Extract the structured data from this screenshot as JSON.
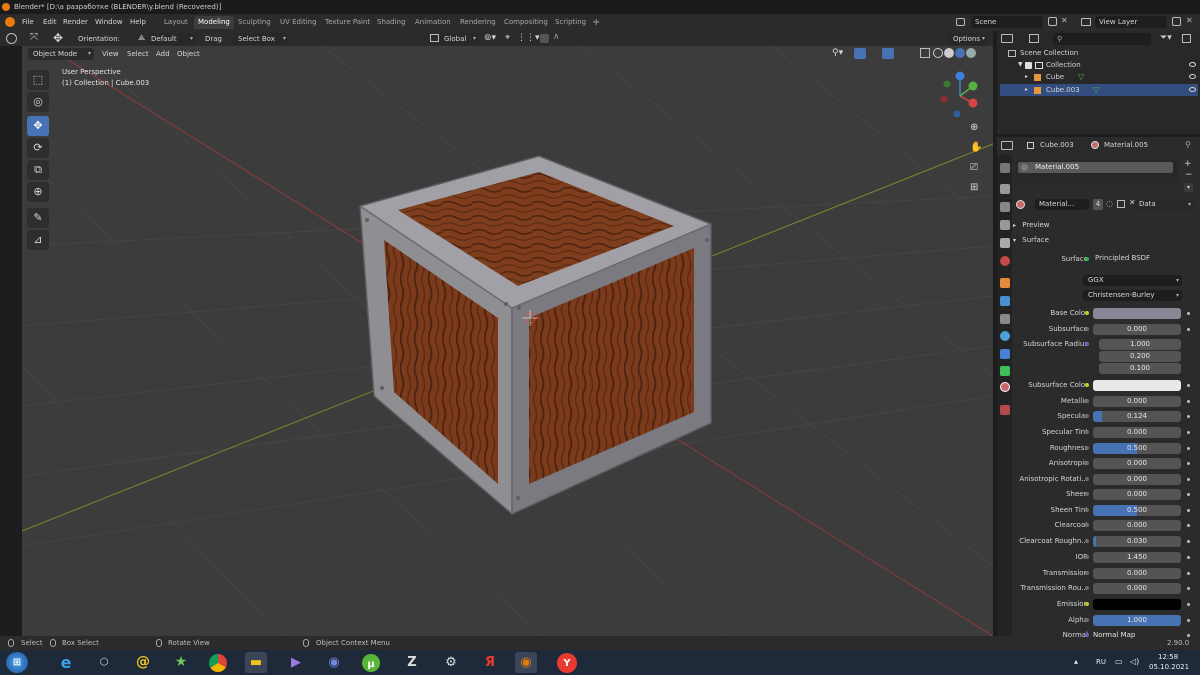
{
  "window": {
    "title": "Blender* [D:\\a разработке (BLENDER\\y.blend (Recovered)]"
  },
  "menu": {
    "items": [
      "File",
      "Edit",
      "Render",
      "Window",
      "Help"
    ],
    "workspaces": [
      "Layout",
      "Modeling",
      "Sculpting",
      "UV Editing",
      "Texture Paint",
      "Shading",
      "Animation",
      "Rendering",
      "Compositing",
      "Scripting"
    ],
    "active_workspace": "Modeling",
    "add_workspace": "+",
    "scene": "Scene",
    "view_layer": "View Layer"
  },
  "tool_header": {
    "orientation_label": "Orientation:",
    "orientation_value": "Default",
    "drag_label": "Drag",
    "drag_value": "Select Box",
    "transform_orientation": "Global",
    "options": "Options"
  },
  "viewport_header": {
    "mode": "Object Mode",
    "menus": [
      "View",
      "Select",
      "Add",
      "Object"
    ]
  },
  "viewport": {
    "perspective": "User Perspective",
    "collection_info": "(1) Collection | Cube.003"
  },
  "outliner": {
    "root": "Scene Collection",
    "items": [
      {
        "name": "Collection"
      },
      {
        "name": "Cube"
      },
      {
        "name": "Cube.003"
      }
    ]
  },
  "properties": {
    "object_name": "Cube.003",
    "material_name": "Material.005",
    "slot_name": "Material.005",
    "material_field": "Material...",
    "user_count": "4",
    "link": "Data",
    "panels": {
      "preview": "Preview",
      "surface": "Surface"
    },
    "surface_label": "Surface",
    "surface_shader": "Principled BSDF",
    "distribution": "GGX",
    "subsurface_method": "Christensen-Burley",
    "rows": [
      {
        "label": "Base Color",
        "type": "color",
        "color": "#8a8797",
        "socket": "yellow"
      },
      {
        "label": "Subsurface",
        "value": "0.000",
        "fill": 0,
        "socket": "gray"
      },
      {
        "label": "Subsurface Radius",
        "multi": [
          "1.000",
          "0.200",
          "0.100"
        ],
        "socket": "purple"
      },
      {
        "label": "Subsurface Color",
        "type": "color",
        "color": "#e8e8e8",
        "socket": "yellow"
      },
      {
        "label": "Metallic",
        "value": "0.000",
        "fill": 0,
        "socket": "gray"
      },
      {
        "label": "Specular",
        "value": "0.124",
        "fill": 0.1,
        "socket": "gray"
      },
      {
        "label": "Specular Tint",
        "value": "0.000",
        "fill": 0,
        "socket": "gray"
      },
      {
        "label": "Roughness",
        "value": "0.500",
        "fill": 0.5,
        "socket": "gray"
      },
      {
        "label": "Anisotropic",
        "value": "0.000",
        "fill": 0,
        "socket": "gray"
      },
      {
        "label": "Anisotropic Rotati...",
        "value": "0.000",
        "fill": 0,
        "socket": "gray"
      },
      {
        "label": "Sheen",
        "value": "0.000",
        "fill": 0,
        "socket": "gray"
      },
      {
        "label": "Sheen Tint",
        "value": "0.500",
        "fill": 0.5,
        "socket": "gray"
      },
      {
        "label": "Clearcoat",
        "value": "0.000",
        "fill": 0,
        "socket": "gray"
      },
      {
        "label": "Clearcoat Roughn...",
        "value": "0.030",
        "fill": 0.03,
        "socket": "gray"
      },
      {
        "label": "IOR",
        "value": "1.450",
        "fill": 0,
        "socket": "gray"
      },
      {
        "label": "Transmission",
        "value": "0.000",
        "fill": 0,
        "socket": "gray"
      },
      {
        "label": "Transmission Rou...",
        "value": "0.000",
        "fill": 0,
        "socket": "gray"
      },
      {
        "label": "Emission",
        "type": "color",
        "color": "#000000",
        "socket": "yellow"
      },
      {
        "label": "Alpha",
        "value": "1.000",
        "fill": 1,
        "socket": "gray"
      },
      {
        "label": "Normal",
        "type": "text",
        "value": "Normal Map",
        "socket": "purple"
      }
    ]
  },
  "status_bar": {
    "select": "Select",
    "box_select": "Box Select",
    "rotate_view": "Rotate View",
    "context_menu": "Object Context Menu",
    "version": "2.90.0"
  },
  "taskbar": {
    "language": "RU",
    "time": "12:58",
    "date": "05.10.2021"
  },
  "colors": {
    "accent": "#4772b3",
    "wood": "#7a3b1c",
    "metal": "#8e8e93"
  }
}
